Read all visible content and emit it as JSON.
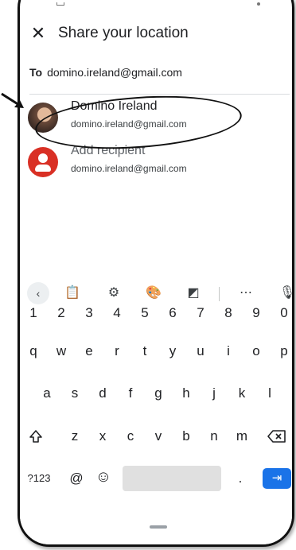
{
  "header": {
    "title": "Share your location",
    "close_icon": "✕"
  },
  "to": {
    "label": "To",
    "value": "domino.ireland@gmail.com"
  },
  "contacts": [
    {
      "name": "Domino Ireland",
      "email": "domino.ireland@gmail.com"
    },
    {
      "name": "Add recipient",
      "email": "domino.ireland@gmail.com"
    }
  ],
  "colors": {
    "accent": "#1a73e8",
    "recipient_icon": "#d93025",
    "annotation": "#111111"
  },
  "keyboard": {
    "toolbar": [
      {
        "name": "back-icon",
        "glyph": "‹"
      },
      {
        "name": "clipboard-icon",
        "glyph": "📋"
      },
      {
        "name": "settings-gear-icon",
        "glyph": "⚙"
      },
      {
        "name": "palette-icon",
        "glyph": "🎨"
      },
      {
        "name": "resize-icon",
        "glyph": "◩"
      },
      {
        "name": "more-dots-icon",
        "glyph": "⋯"
      },
      {
        "name": "microphone-icon",
        "glyph": "🎙"
      }
    ],
    "row_numbers": [
      "1",
      "2",
      "3",
      "4",
      "5",
      "6",
      "7",
      "8",
      "9",
      "0"
    ],
    "row_q": [
      "q",
      "w",
      "e",
      "r",
      "t",
      "y",
      "u",
      "i",
      "o",
      "p"
    ],
    "row_a": [
      "a",
      "s",
      "d",
      "f",
      "g",
      "h",
      "j",
      "k",
      "l"
    ],
    "row_z": [
      "z",
      "x",
      "c",
      "v",
      "b",
      "n",
      "m"
    ],
    "bottom": {
      "symbols": "?123",
      "at": "@",
      "emoji": "☺",
      "period": ".",
      "enter": "⇥"
    }
  }
}
